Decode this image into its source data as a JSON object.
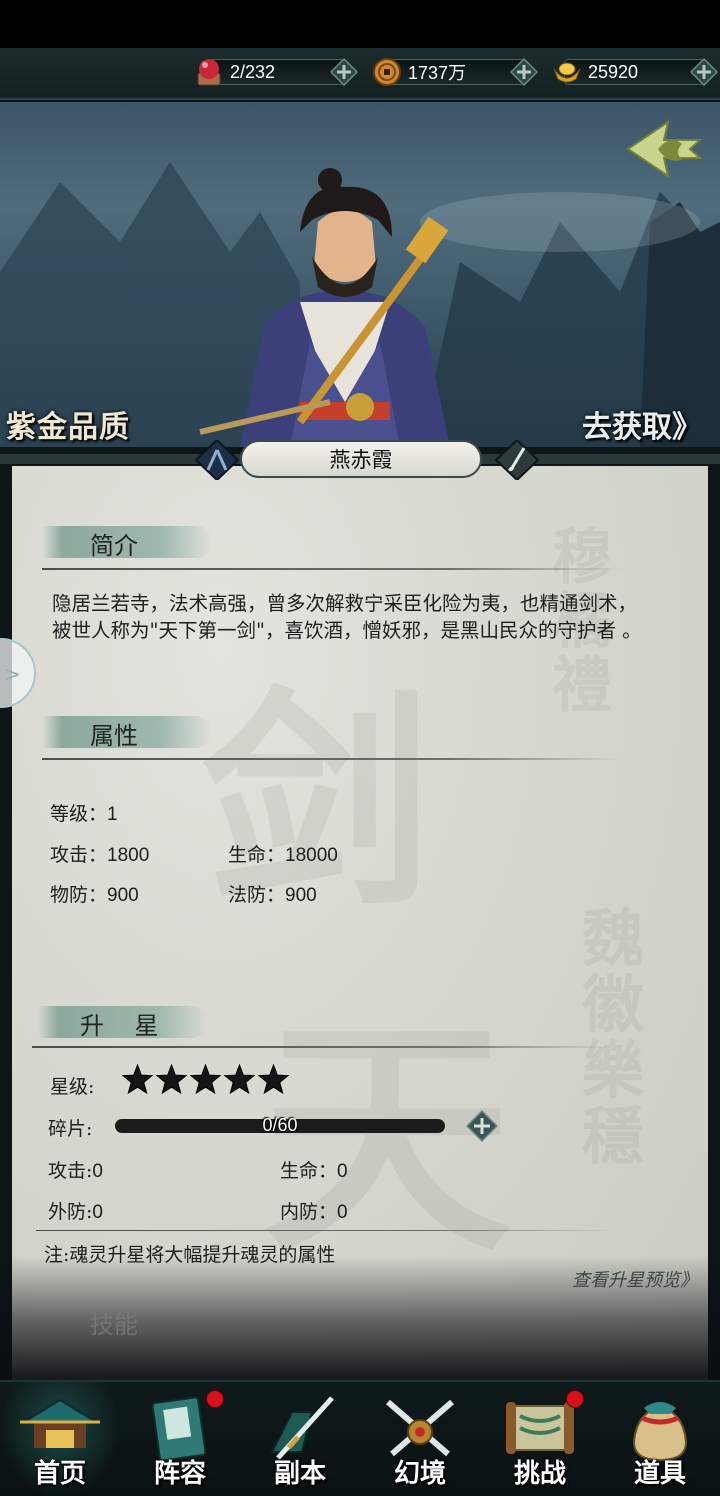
{
  "resources": [
    {
      "name": "stamina",
      "value": "2/232",
      "icon": "red-orb-icon"
    },
    {
      "name": "coins",
      "value": "1737万",
      "icon": "copper-coin-icon"
    },
    {
      "name": "ingots",
      "value": "25920",
      "icon": "gold-ingot-icon"
    }
  ],
  "hero": {
    "quality": "紫金品质",
    "obtain": "去获取》",
    "name": "燕赤霞"
  },
  "intro": {
    "title": "简介",
    "text": "隐居兰若寺，法术高强，曾多次解救宁采臣化险为夷，也精通剑术，被世人称为\"天下第一剑\"，喜饮酒，憎妖邪，是黑山民众的守护者 。"
  },
  "attributes": {
    "title": "属性",
    "level_label": "等级：",
    "level": "1",
    "attack_label": "攻击：",
    "attack": "1800",
    "hp_label": "生命：",
    "hp": "18000",
    "pdef_label": "物防：",
    "pdef": "900",
    "mdef_label": "法防：",
    "mdef": "900"
  },
  "star_up": {
    "title": "升    星",
    "star_label": "星级:",
    "stars": 5,
    "fragment_label": "碎片:",
    "fragment_text": "0/60",
    "fragment_progress": 0,
    "attack_label": "攻击:",
    "attack": "0",
    "hp_label": "生命：",
    "hp": "0",
    "outer_def_label": "外防:",
    "outer_def": "0",
    "inner_def_label": "内防：",
    "inner_def": "0",
    "note": "注:魂灵升星将大幅提升魂灵的属性",
    "preview_link": "查看升星预览》"
  },
  "skills": {
    "title": "技能"
  },
  "nav": [
    {
      "label": "首页",
      "icon": "pavilion-home-icon",
      "badge": false
    },
    {
      "label": "阵容",
      "icon": "book-lineup-icon",
      "badge": true
    },
    {
      "label": "副本",
      "icon": "sword-dungeon-icon",
      "badge": false
    },
    {
      "label": "幻境",
      "icon": "crossed-swords-icon",
      "badge": false
    },
    {
      "label": "挑战",
      "icon": "scroll-challenge-icon",
      "badge": true
    },
    {
      "label": "道具",
      "icon": "treasure-bag-icon",
      "badge": false
    }
  ],
  "colors": {
    "badge": "#d8121c",
    "accent_green": "#7ea092",
    "parchment": "#d8dad3"
  }
}
